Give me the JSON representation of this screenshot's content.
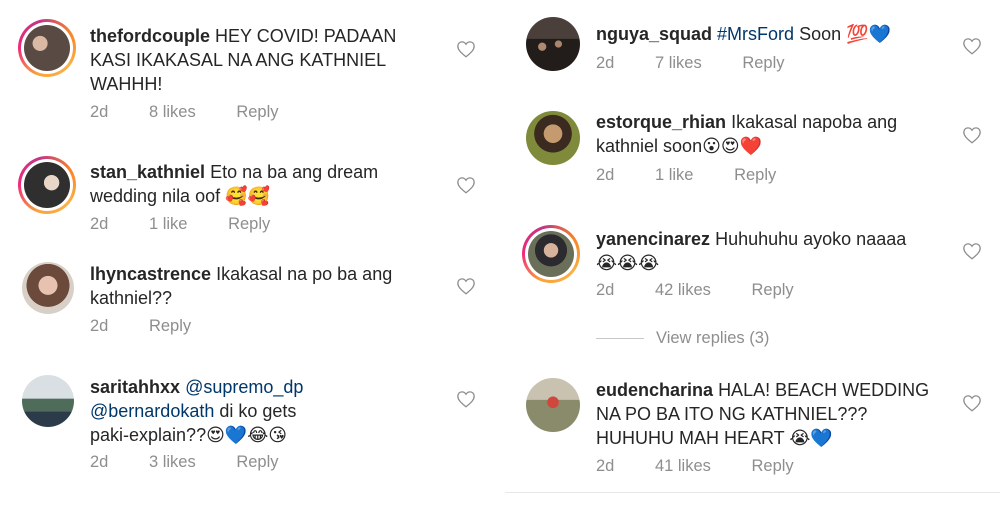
{
  "left": [
    {
      "username": "thefordcouple",
      "text_lines": [
        "HEY COVID! PADAAN",
        "KASI IKAKASAL NA ANG KATHNIEL",
        "WAHHH!"
      ],
      "time": "2d",
      "likes": "8 likes",
      "reply": "Reply",
      "story_ring": true,
      "avatar_color": "#5a4a44"
    },
    {
      "username": "stan_kathniel",
      "text_lines": [
        "Eto na ba ang dream",
        "wedding nila oof 🥰🥰"
      ],
      "time": "2d",
      "likes": "1 like",
      "reply": "Reply",
      "story_ring": true,
      "avatar_color": "#3b3b3b"
    },
    {
      "username": "lhyncastrence",
      "text_lines": [
        "Ikakasal na po ba ang",
        "kathniel??"
      ],
      "time": "2d",
      "likes": "",
      "reply": "Reply",
      "story_ring": false,
      "avatar_color": "#c89a8a"
    },
    {
      "username": "saritahhxx",
      "mention1": "@supremo_dp",
      "mention2": "@bernardokath",
      "line2_rest": " di ko gets",
      "line3": "paki-explain??😍💙😂😘",
      "time": "2d",
      "likes": "3 likes",
      "reply": "Reply",
      "story_ring": false,
      "avatar_color": "#6b7a6a"
    }
  ],
  "right": [
    {
      "username": "nguya_squad",
      "mention": "#MrsFord",
      "rest": " Soon 💯💙",
      "time": "2d",
      "likes": "7 likes",
      "reply": "Reply",
      "story_ring": false,
      "avatar_color": "#2e2a28"
    },
    {
      "username": "estorque_rhian",
      "text_lines": [
        "Ikakasal napoba ang",
        "kathniel soon😮😍❤️"
      ],
      "time": "2d",
      "likes": "1 like",
      "reply": "Reply",
      "story_ring": false,
      "avatar_color": "#8a7a3e"
    },
    {
      "username": "yanencinarez",
      "text_lines": [
        "Huhuhuhu ayoko naaaa",
        "😭😭😭"
      ],
      "time": "2d",
      "likes": "42 likes",
      "reply": "Reply",
      "story_ring": true,
      "avatar_color": "#4b4a52"
    },
    {
      "username": "eudencharina",
      "text_lines": [
        "HALA! BEACH WEDDING",
        "NA PO BA ITO NG KATHNIEL???",
        "HUHUHU MAH HEART 😭💙"
      ],
      "time": "2d",
      "likes": "41 likes",
      "reply": "Reply",
      "story_ring": false,
      "avatar_color": "#8f8470"
    }
  ],
  "view_replies": "View replies (3)",
  "colors": {
    "text": "#262626",
    "meta": "#8e8e8e",
    "mention": "#00376b",
    "ring_start": "#f9a33b",
    "ring_end": "#c13584"
  }
}
